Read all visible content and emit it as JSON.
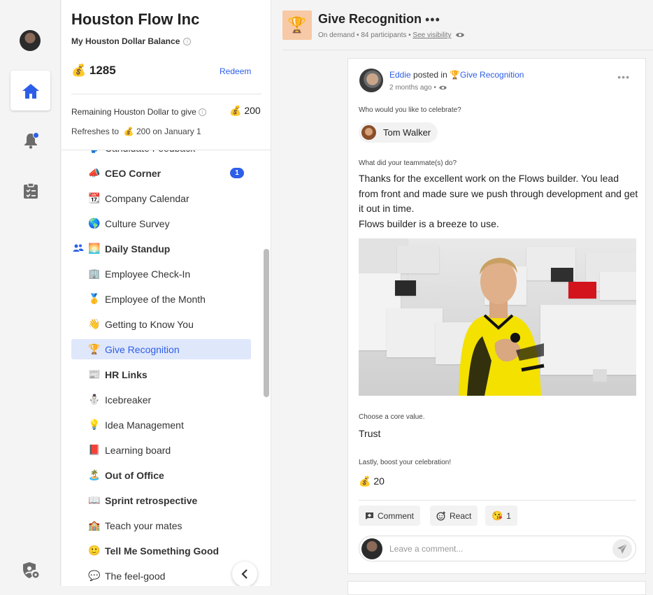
{
  "company": "Houston Flow Inc",
  "balance": {
    "label": "My Houston Dollar Balance",
    "info_icon": "info-icon",
    "amount": "💰 1285",
    "redeem": "Redeem"
  },
  "give": {
    "label": "Remaining Houston Dollar to give",
    "amount": "💰 200",
    "refresh_prefix": "Refreshes to",
    "refresh_amount": "💰 200 on January 1"
  },
  "channels": [
    {
      "emoji": "🗣️",
      "name": "Candidate Feedback",
      "bold": false
    },
    {
      "emoji": "📣",
      "name": "CEO Corner",
      "bold": true,
      "badge": "1"
    },
    {
      "emoji": "📆",
      "name": "Company Calendar",
      "bold": false
    },
    {
      "emoji": "🌎",
      "name": "Culture Survey",
      "bold": false
    },
    {
      "emoji": "🌅",
      "name": "Daily Standup",
      "bold": true,
      "people": true
    },
    {
      "emoji": "🏢",
      "name": "Employee Check-In",
      "bold": false
    },
    {
      "emoji": "🥇",
      "name": "Employee of the Month",
      "bold": false
    },
    {
      "emoji": "👋",
      "name": "Getting to Know You",
      "bold": false
    },
    {
      "emoji": "🏆",
      "name": "Give Recognition",
      "bold": false,
      "selected": true
    },
    {
      "emoji": "📰",
      "name": "HR Links",
      "bold": true
    },
    {
      "emoji": "⛄",
      "name": "Icebreaker",
      "bold": false
    },
    {
      "emoji": "💡",
      "name": "Idea Management",
      "bold": false
    },
    {
      "emoji": "📕",
      "name": "Learning board",
      "bold": false
    },
    {
      "emoji": "🏝️",
      "name": "Out of Office",
      "bold": true
    },
    {
      "emoji": "📖",
      "name": "Sprint retrospective",
      "bold": true
    },
    {
      "emoji": "🏫",
      "name": "Teach your mates",
      "bold": false
    },
    {
      "emoji": "🙂",
      "name": "Tell Me Something Good",
      "bold": true
    },
    {
      "emoji": "💬",
      "name": "The feel-good",
      "bold": false
    }
  ],
  "header": {
    "icon": "🏆",
    "title": "Give Recognition",
    "more": "•••",
    "meta": "On demand • 84 participants • ",
    "visibility": "See visibility"
  },
  "post": {
    "author": "Eddie",
    "posted_in": "posted in",
    "channel": "🏆Give Recognition",
    "time": "2 months ago •",
    "q1": "Who would you like to celebrate?",
    "recipient": "Tom Walker",
    "q2": "What did your teammate(s) do?",
    "body_lines": [
      "Thanks for the excellent work on the Flows builder. You lead from front and made sure we push through development and get it out in time.",
      "Flows builder is a breeze to use."
    ],
    "q3": "Choose a core value.",
    "value": "Trust",
    "q4": "Lastly, boost your celebration!",
    "boost": "💰 20"
  },
  "actions": {
    "comment": "Comment",
    "react": "React",
    "reaction_count": "1",
    "comment_placeholder": "Leave a comment..."
  },
  "colors": {
    "accent": "#2d5ee8",
    "selected_bg": "#dfe7fb",
    "header_icon_bg": "#f7c9a6"
  }
}
